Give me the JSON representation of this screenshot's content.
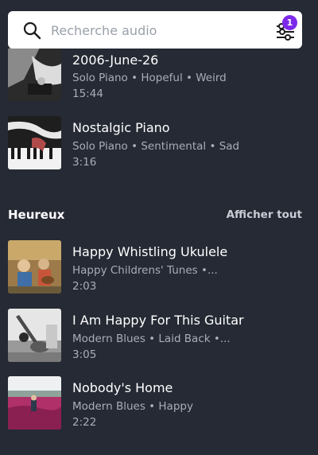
{
  "search": {
    "placeholder": "Recherche audio",
    "filter_badge": "1"
  },
  "top_tracks": [
    {
      "title": "2006-June-26",
      "meta": "Solo Piano • Hopeful • Weird",
      "duration": "15:44"
    },
    {
      "title": "Nostalgic Piano",
      "meta": "Solo Piano • Sentimental • Sad",
      "duration": "3:16"
    }
  ],
  "section": {
    "title": "Heureux",
    "see_all": "Afficher tout"
  },
  "happy_tracks": [
    {
      "title": "Happy Whistling Ukulele",
      "meta": "Happy Childrens' Tunes •...",
      "duration": "2:03"
    },
    {
      "title": "I Am Happy For This Guitar",
      "meta": "Modern Blues • Laid Back •...",
      "duration": "3:05"
    },
    {
      "title": "Nobody's Home",
      "meta": "Modern Blues • Happy",
      "duration": "2:22"
    }
  ],
  "colors": {
    "background": "#252a34",
    "accent": "#7d2ae8",
    "meta_text": "#a8aeb8"
  }
}
